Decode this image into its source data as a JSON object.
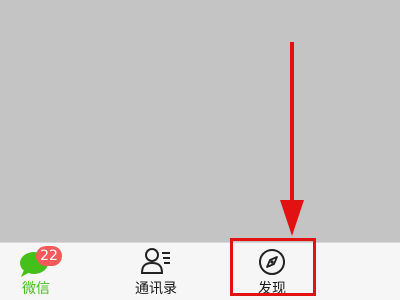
{
  "tabbar": {
    "tabs": [
      {
        "label": "微信",
        "icon": "chat-bubble-icon",
        "badge": "22",
        "active": true
      },
      {
        "label": "通讯录",
        "icon": "contacts-icon"
      },
      {
        "label": "发现",
        "icon": "compass-icon"
      }
    ]
  },
  "annotation": {
    "arrow_color": "#e21212",
    "highlight_target": "发现"
  },
  "colors": {
    "background": "#c4c4c4",
    "tabbar_bg": "#f6f6f6",
    "accent_green": "#45c01a",
    "badge_red": "#f65a5a"
  }
}
